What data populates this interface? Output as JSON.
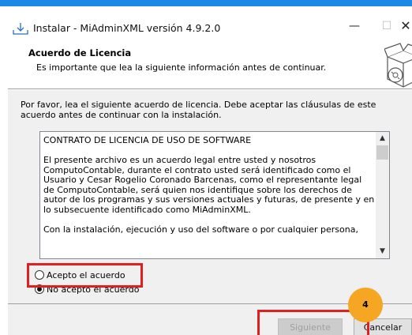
{
  "window": {
    "title": "Instalar - MiAdminXML versión 4.9.2.0",
    "minimize": "—",
    "maximize": "☐",
    "close": "✕"
  },
  "header": {
    "title": "Acuerdo de Licencia",
    "subtitle": "Es importante que lea la siguiente información antes de continuar."
  },
  "content": {
    "intro": "Por favor, lea el siguiente acuerdo de licencia. Debe aceptar las cláusulas de este acuerdo antes de continuar con la instalación.",
    "license_paragraphs": [
      "CONTRATO DE LICENCIA DE USO DE SOFTWARE",
      "",
      "El presente archivo es un acuerdo legal entre usted y nosotros ComputoContable, durante el contrato usted será identificado como el Usuario y Cesar Rogelio Coronado Barcenas, como el representante legal de ComputoContable, será quien nos identifique sobre los derechos de autor de los programas y sus versiones actuales y futuras, de presente y en lo subsecuente identificado como MiAdminXML.",
      "Con la instalación, ejecución y uso del software o por cualquier persona,"
    ],
    "radio_accept": "Acepto el acuerdo",
    "radio_reject": "No acepto el acuerdo",
    "selected": "reject"
  },
  "footer": {
    "next_label": "Siguiente",
    "cancel_label": "Cancelar"
  },
  "annotations": {
    "step_badge": "4",
    "highlight_color": "#e02020",
    "badge_color": "#f5a623"
  },
  "icons": {
    "title_icon": "installer-icon",
    "header_icon": "software-box-icon",
    "scroll_up": "▲",
    "scroll_down": "▼"
  }
}
